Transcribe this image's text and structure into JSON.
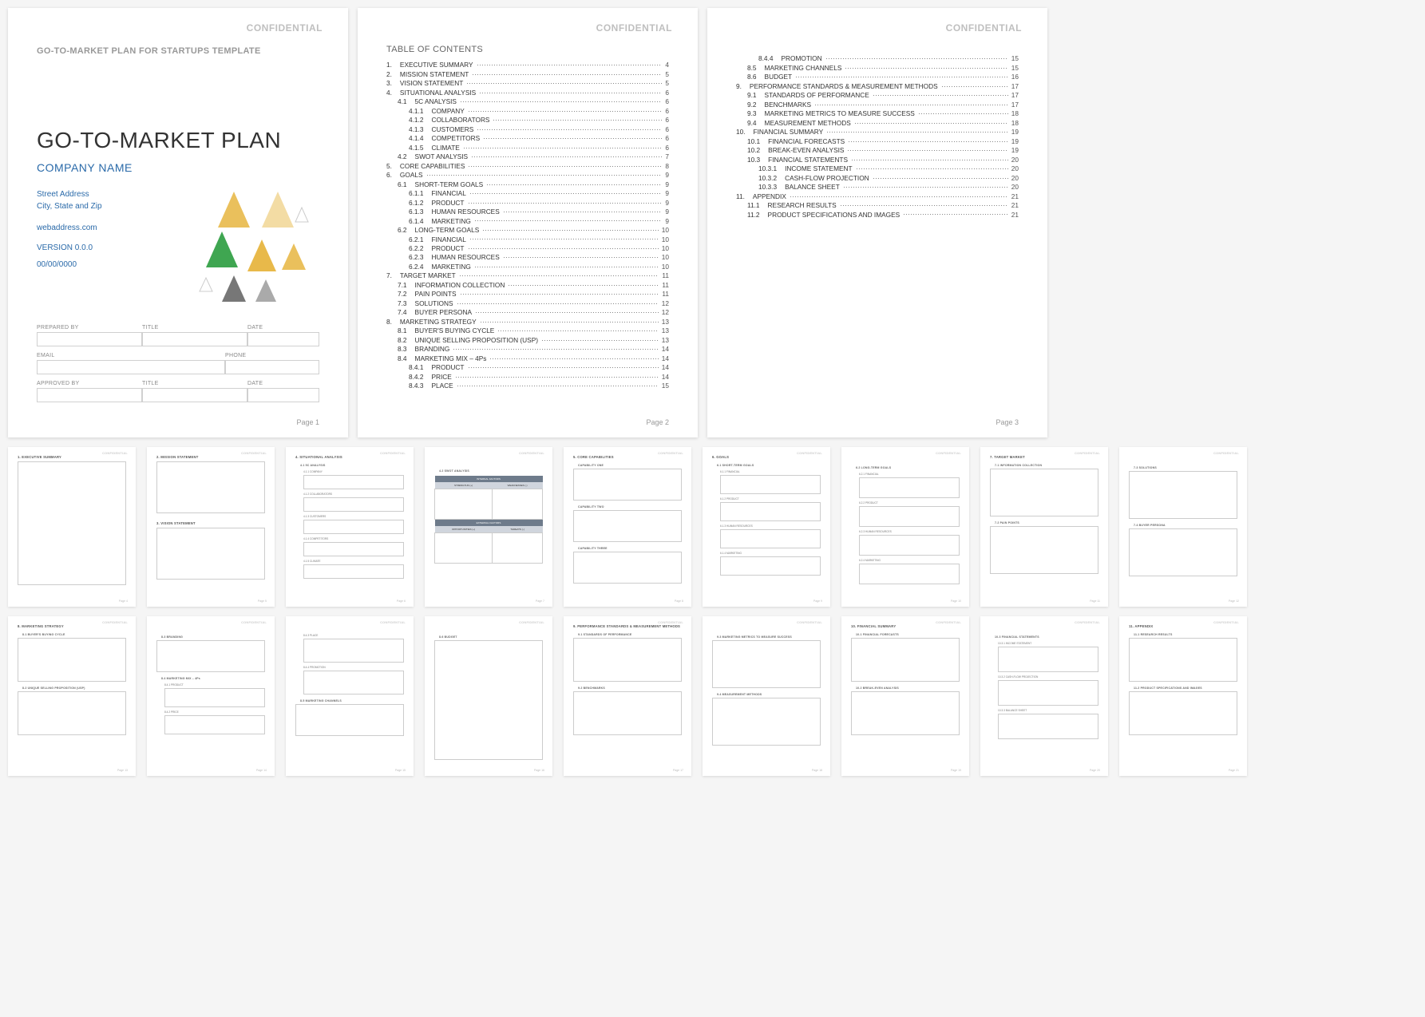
{
  "confidential_label": "CONFIDENTIAL",
  "page_label_prefix": "Page",
  "cover": {
    "template_header": "GO-TO-MARKET PLAN FOR STARTUPS TEMPLATE",
    "title": "GO-TO-MARKET PLAN",
    "company": "COMPANY NAME",
    "street": "Street Address",
    "city": "City, State and Zip",
    "web": "webaddress.com",
    "version": "VERSION 0.0.0",
    "date": "00/00/0000",
    "fields": {
      "prepared_by": "PREPARED BY",
      "title": "TITLE",
      "date_lbl": "DATE",
      "email": "EMAIL",
      "phone": "PHONE",
      "approved_by": "APPROVED BY"
    },
    "page_num": "1"
  },
  "toc_title": "TABLE OF CONTENTS",
  "toc_page2": [
    {
      "n": "1.",
      "t": "EXECUTIVE SUMMARY",
      "p": "4",
      "i": 0
    },
    {
      "n": "2.",
      "t": "MISSION STATEMENT",
      "p": "5",
      "i": 0
    },
    {
      "n": "3.",
      "t": "VISION STATEMENT",
      "p": "5",
      "i": 0
    },
    {
      "n": "4.",
      "t": "SITUATIONAL ANALYSIS",
      "p": "6",
      "i": 0
    },
    {
      "n": "4.1",
      "t": "5C ANALYSIS",
      "p": "6",
      "i": 1
    },
    {
      "n": "4.1.1",
      "t": "COMPANY",
      "p": "6",
      "i": 2
    },
    {
      "n": "4.1.2",
      "t": "COLLABORATORS",
      "p": "6",
      "i": 2
    },
    {
      "n": "4.1.3",
      "t": "CUSTOMERS",
      "p": "6",
      "i": 2
    },
    {
      "n": "4.1.4",
      "t": "COMPETITORS",
      "p": "6",
      "i": 2
    },
    {
      "n": "4.1.5",
      "t": "CLIMATE",
      "p": "6",
      "i": 2
    },
    {
      "n": "4.2",
      "t": "SWOT ANALYSIS",
      "p": "7",
      "i": 1
    },
    {
      "n": "5.",
      "t": "CORE CAPABILITIES",
      "p": "8",
      "i": 0
    },
    {
      "n": "6.",
      "t": "GOALS",
      "p": "9",
      "i": 0
    },
    {
      "n": "6.1",
      "t": "SHORT-TERM GOALS",
      "p": "9",
      "i": 1
    },
    {
      "n": "6.1.1",
      "t": "FINANCIAL",
      "p": "9",
      "i": 2
    },
    {
      "n": "6.1.2",
      "t": "PRODUCT",
      "p": "9",
      "i": 2
    },
    {
      "n": "6.1.3",
      "t": "HUMAN RESOURCES",
      "p": "9",
      "i": 2
    },
    {
      "n": "6.1.4",
      "t": "MARKETING",
      "p": "9",
      "i": 2
    },
    {
      "n": "6.2",
      "t": "LONG-TERM GOALS",
      "p": "10",
      "i": 1
    },
    {
      "n": "6.2.1",
      "t": "FINANCIAL",
      "p": "10",
      "i": 2
    },
    {
      "n": "6.2.2",
      "t": "PRODUCT",
      "p": "10",
      "i": 2
    },
    {
      "n": "6.2.3",
      "t": "HUMAN RESOURCES",
      "p": "10",
      "i": 2
    },
    {
      "n": "6.2.4",
      "t": "MARKETING",
      "p": "10",
      "i": 2
    },
    {
      "n": "7.",
      "t": "TARGET MARKET",
      "p": "11",
      "i": 0
    },
    {
      "n": "7.1",
      "t": "INFORMATION COLLECTION",
      "p": "11",
      "i": 1
    },
    {
      "n": "7.2",
      "t": "PAIN POINTS",
      "p": "11",
      "i": 1
    },
    {
      "n": "7.3",
      "t": "SOLUTIONS",
      "p": "12",
      "i": 1
    },
    {
      "n": "7.4",
      "t": "BUYER PERSONA",
      "p": "12",
      "i": 1
    },
    {
      "n": "8.",
      "t": "MARKETING STRATEGY",
      "p": "13",
      "i": 0
    },
    {
      "n": "8.1",
      "t": "BUYER'S BUYING CYCLE",
      "p": "13",
      "i": 1
    },
    {
      "n": "8.2",
      "t": "UNIQUE SELLING PROPOSITION (USP)",
      "p": "13",
      "i": 1
    },
    {
      "n": "8.3",
      "t": "BRANDING",
      "p": "14",
      "i": 1
    },
    {
      "n": "8.4",
      "t": "MARKETING MIX – 4Ps",
      "p": "14",
      "i": 1
    },
    {
      "n": "8.4.1",
      "t": "PRODUCT",
      "p": "14",
      "i": 2
    },
    {
      "n": "8.4.2",
      "t": "PRICE",
      "p": "14",
      "i": 2
    },
    {
      "n": "8.4.3",
      "t": "PLACE",
      "p": "15",
      "i": 2
    }
  ],
  "toc_page3": [
    {
      "n": "8.4.4",
      "t": "PROMOTION",
      "p": "15",
      "i": 2
    },
    {
      "n": "8.5",
      "t": "MARKETING CHANNELS",
      "p": "15",
      "i": 1
    },
    {
      "n": "8.6",
      "t": "BUDGET",
      "p": "16",
      "i": 1
    },
    {
      "n": "9.",
      "t": "PERFORMANCE STANDARDS & MEASUREMENT METHODS",
      "p": "17",
      "i": 0
    },
    {
      "n": "9.1",
      "t": "STANDARDS OF PERFORMANCE",
      "p": "17",
      "i": 1
    },
    {
      "n": "9.2",
      "t": "BENCHMARKS",
      "p": "17",
      "i": 1
    },
    {
      "n": "9.3",
      "t": "MARKETING METRICS TO MEASURE SUCCESS",
      "p": "18",
      "i": 1
    },
    {
      "n": "9.4",
      "t": "MEASUREMENT METHODS",
      "p": "18",
      "i": 1
    },
    {
      "n": "10.",
      "t": "FINANCIAL SUMMARY",
      "p": "19",
      "i": 0
    },
    {
      "n": "10.1",
      "t": "FINANCIAL FORECASTS",
      "p": "19",
      "i": 1
    },
    {
      "n": "10.2",
      "t": "BREAK-EVEN ANALYSIS",
      "p": "19",
      "i": 1
    },
    {
      "n": "10.3",
      "t": "FINANCIAL STATEMENTS",
      "p": "20",
      "i": 1
    },
    {
      "n": "10.3.1",
      "t": "INCOME STATEMENT",
      "p": "20",
      "i": 2
    },
    {
      "n": "10.3.2",
      "t": "CASH-FLOW PROJECTION",
      "p": "20",
      "i": 2
    },
    {
      "n": "10.3.3",
      "t": "BALANCE SHEET",
      "p": "20",
      "i": 2
    },
    {
      "n": "11.",
      "t": "APPENDIX",
      "p": "21",
      "i": 0
    },
    {
      "n": "11.1",
      "t": "RESEARCH RESULTS",
      "p": "21",
      "i": 1
    },
    {
      "n": "11.2",
      "t": "PRODUCT SPECIFICATIONS AND IMAGES",
      "p": "21",
      "i": 1
    }
  ],
  "page2_num": "2",
  "page3_num": "3",
  "thumbs": {
    "p4": {
      "h": "1. EXECUTIVE SUMMARY",
      "pn": "Page 4"
    },
    "p5": {
      "h1": "2. MISSION STATEMENT",
      "h2": "3. VISION STATEMENT",
      "pn": "Page 5"
    },
    "p6": {
      "h": "4. SITUATIONAL ANALYSIS",
      "s1": "4.1  5C ANALYSIS",
      "c1": "4.1.1  COMPANY",
      "c2": "4.1.2  COLLABORATORS",
      "c3": "4.1.3  CUSTOMERS",
      "c4": "4.1.4  COMPETITORS",
      "c5": "4.1.5  CLIMATE",
      "pn": "Page 6"
    },
    "p7": {
      "s1": "4.2  SWOT ANALYSIS",
      "int": "INTERNAL FACTORS",
      "ext": "EXTERNAL FACTORS",
      "str": "STRENGTHS (+)",
      "wk": "WEAKNESSES (-)",
      "op": "OPPORTUNITIES (+)",
      "th": "THREATS (-)",
      "pn": "Page 7"
    },
    "p8": {
      "h": "5. CORE CAPABILITIES",
      "c1": "CAPABILITY ONE",
      "c2": "CAPABILITY TWO",
      "c3": "CAPABILITY THREE",
      "pn": "Page 8"
    },
    "p9": {
      "h": "6. GOALS",
      "s1": "6.1  SHORT-TERM GOALS",
      "c1": "6.1.1  FINANCIAL",
      "c2": "6.1.2  PRODUCT",
      "c3": "6.1.3  HUMAN RESOURCES",
      "c4": "6.1.4  MARKETING",
      "pn": "Page 9"
    },
    "p10": {
      "s1": "6.2  LONG-TERM GOALS",
      "c1": "6.2.1  FINANCIAL",
      "c2": "6.2.2  PRODUCT",
      "c3": "6.2.3  HUMAN RESOURCES",
      "c4": "6.2.4  MARKETING",
      "pn": "Page 10"
    },
    "p11": {
      "h": "7. TARGET MARKET",
      "s1": "7.1  INFORMATION COLLECTION",
      "s2": "7.2  PAIN POINTS",
      "pn": "Page 11"
    },
    "p12": {
      "s1": "7.3  SOLUTIONS",
      "s2": "7.4  BUYER PERSONA",
      "pn": "Page 12"
    },
    "p13": {
      "h": "8. MARKETING STRATEGY",
      "s1": "8.1  BUYER'S BUYING CYCLE",
      "s2": "8.2  UNIQUE SELLING PROPOSITION (USP)",
      "pn": "Page 13"
    },
    "p14": {
      "s1": "8.3  BRANDING",
      "s2": "8.4  MARKETING MIX – 4Ps",
      "c1": "8.4.1  PRODUCT",
      "c2": "8.4.2  PRICE",
      "pn": "Page 14"
    },
    "p15": {
      "c1": "8.4.3  PLACE",
      "c2": "8.4.4  PROMOTION",
      "s1": "8.5  MARKETING CHANNELS",
      "pn": "Page 15"
    },
    "p16": {
      "s1": "8.6  BUDGET",
      "pn": "Page 16"
    },
    "p17": {
      "h": "9. PERFORMANCE STANDARDS & MEASUREMENT METHODS",
      "s1": "9.1  STANDARDS OF PERFORMANCE",
      "s2": "9.2  BENCHMARKS",
      "pn": "Page 17"
    },
    "p18": {
      "s1": "9.3  MARKETING METRICS TO MEASURE SUCCESS",
      "s2": "9.4  MEASUREMENT METHODS",
      "pn": "Page 18"
    },
    "p19": {
      "h": "10. FINANCIAL SUMMARY",
      "s1": "10.1  FINANCIAL FORECASTS",
      "s2": "10.2  BREAK-EVEN ANALYSIS",
      "pn": "Page 19"
    },
    "p20": {
      "s1": "10.3  FINANCIAL STATEMENTS",
      "c1": "10.3.1  INCOME STATEMENT",
      "c2": "10.3.2  CASH-FLOW PROJECTION",
      "c3": "10.3.3  BALANCE SHEET",
      "pn": "Page 20"
    },
    "p21": {
      "h": "11. APPENDIX",
      "s1": "11.1  RESEARCH RESULTS",
      "s2": "11.2  PRODUCT SPECIFICATIONS AND IMAGES",
      "pn": "Page 21"
    }
  }
}
